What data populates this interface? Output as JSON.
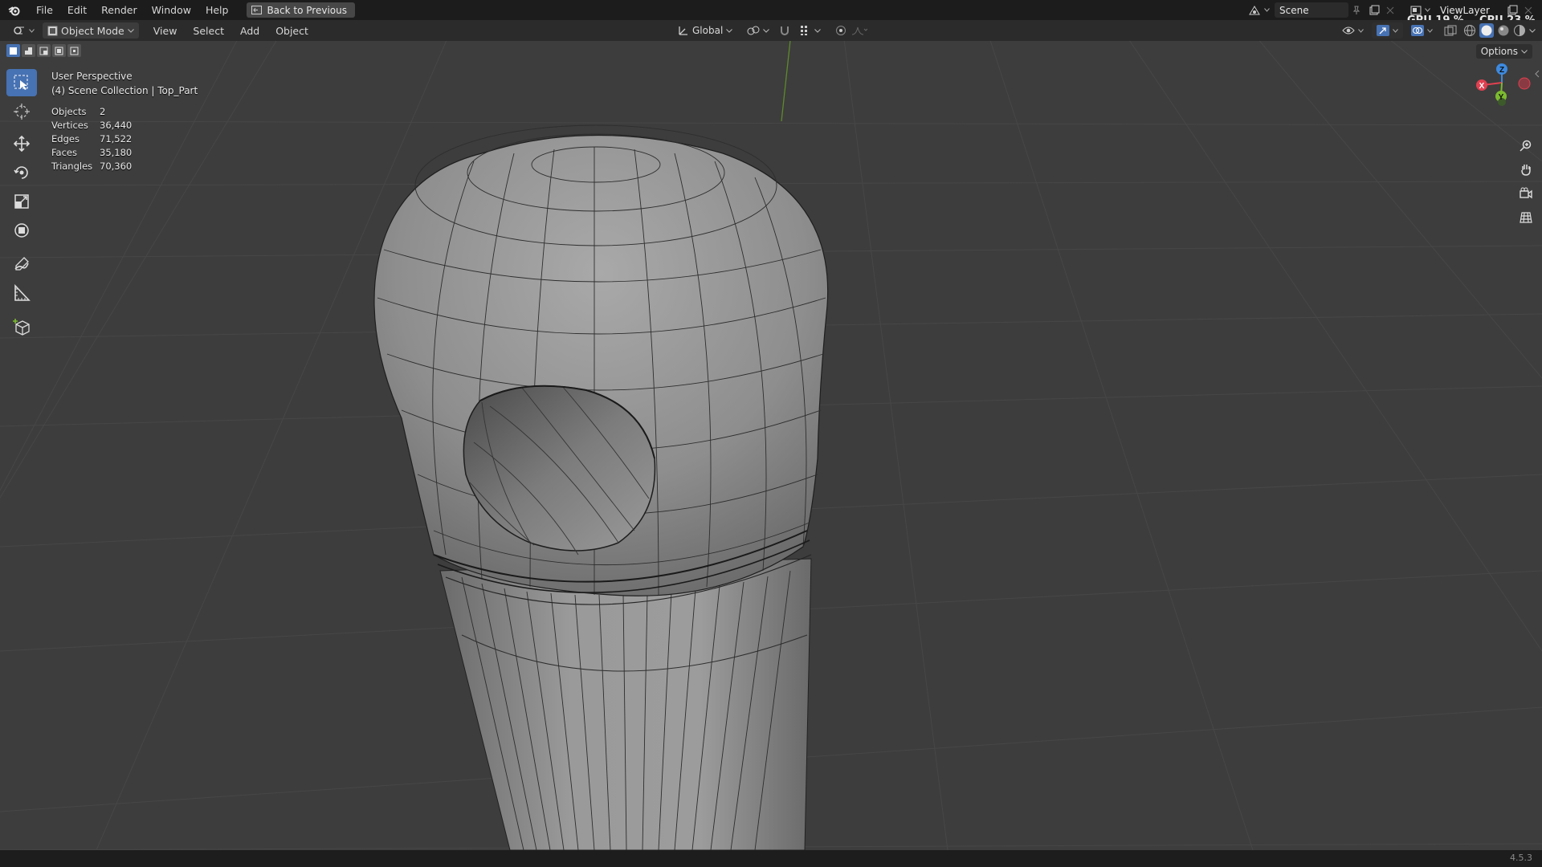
{
  "menu": {
    "items": [
      "File",
      "Edit",
      "Render",
      "Window",
      "Help"
    ],
    "back_button": "Back to Previous"
  },
  "top_right": {
    "scene": "Scene",
    "view_layer": "ViewLayer",
    "gpu_label": "GPU",
    "gpu_value": "19 %",
    "cpu_label": "CPU",
    "cpu_value": "23 %"
  },
  "header": {
    "mode": "Object Mode",
    "menus": [
      "View",
      "Select",
      "Add",
      "Object"
    ],
    "orientation": "Global"
  },
  "viewport": {
    "perspective": "User Perspective",
    "collection": "(4) Scene Collection | Top_Part",
    "options_label": "Options",
    "stats": [
      {
        "label": "Objects",
        "value": "2"
      },
      {
        "label": "Vertices",
        "value": "36,440"
      },
      {
        "label": "Edges",
        "value": "71,522"
      },
      {
        "label": "Faces",
        "value": "35,180"
      },
      {
        "label": "Triangles",
        "value": "70,360"
      }
    ],
    "gizmo": {
      "x": "X",
      "y": "Y",
      "z": "Z"
    }
  },
  "status": {
    "version": "4.5.3"
  },
  "colors": {
    "accent": "#4772b3",
    "axis_x": "#e04050",
    "axis_y": "#7cbb2f",
    "axis_z": "#3d8ae0"
  }
}
